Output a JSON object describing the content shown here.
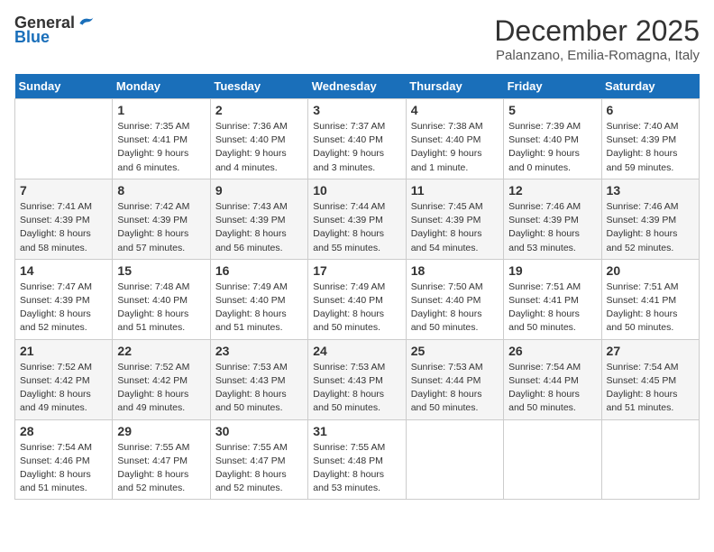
{
  "header": {
    "logo_general": "General",
    "logo_blue": "Blue",
    "month_title": "December 2025",
    "location": "Palanzano, Emilia-Romagna, Italy"
  },
  "days_of_week": [
    "Sunday",
    "Monday",
    "Tuesday",
    "Wednesday",
    "Thursday",
    "Friday",
    "Saturday"
  ],
  "weeks": [
    [
      {
        "day": "",
        "info": ""
      },
      {
        "day": "1",
        "info": "Sunrise: 7:35 AM\nSunset: 4:41 PM\nDaylight: 9 hours\nand 6 minutes."
      },
      {
        "day": "2",
        "info": "Sunrise: 7:36 AM\nSunset: 4:40 PM\nDaylight: 9 hours\nand 4 minutes."
      },
      {
        "day": "3",
        "info": "Sunrise: 7:37 AM\nSunset: 4:40 PM\nDaylight: 9 hours\nand 3 minutes."
      },
      {
        "day": "4",
        "info": "Sunrise: 7:38 AM\nSunset: 4:40 PM\nDaylight: 9 hours\nand 1 minute."
      },
      {
        "day": "5",
        "info": "Sunrise: 7:39 AM\nSunset: 4:40 PM\nDaylight: 9 hours\nand 0 minutes."
      },
      {
        "day": "6",
        "info": "Sunrise: 7:40 AM\nSunset: 4:39 PM\nDaylight: 8 hours\nand 59 minutes."
      }
    ],
    [
      {
        "day": "7",
        "info": "Sunrise: 7:41 AM\nSunset: 4:39 PM\nDaylight: 8 hours\nand 58 minutes."
      },
      {
        "day": "8",
        "info": "Sunrise: 7:42 AM\nSunset: 4:39 PM\nDaylight: 8 hours\nand 57 minutes."
      },
      {
        "day": "9",
        "info": "Sunrise: 7:43 AM\nSunset: 4:39 PM\nDaylight: 8 hours\nand 56 minutes."
      },
      {
        "day": "10",
        "info": "Sunrise: 7:44 AM\nSunset: 4:39 PM\nDaylight: 8 hours\nand 55 minutes."
      },
      {
        "day": "11",
        "info": "Sunrise: 7:45 AM\nSunset: 4:39 PM\nDaylight: 8 hours\nand 54 minutes."
      },
      {
        "day": "12",
        "info": "Sunrise: 7:46 AM\nSunset: 4:39 PM\nDaylight: 8 hours\nand 53 minutes."
      },
      {
        "day": "13",
        "info": "Sunrise: 7:46 AM\nSunset: 4:39 PM\nDaylight: 8 hours\nand 52 minutes."
      }
    ],
    [
      {
        "day": "14",
        "info": "Sunrise: 7:47 AM\nSunset: 4:39 PM\nDaylight: 8 hours\nand 52 minutes."
      },
      {
        "day": "15",
        "info": "Sunrise: 7:48 AM\nSunset: 4:40 PM\nDaylight: 8 hours\nand 51 minutes."
      },
      {
        "day": "16",
        "info": "Sunrise: 7:49 AM\nSunset: 4:40 PM\nDaylight: 8 hours\nand 51 minutes."
      },
      {
        "day": "17",
        "info": "Sunrise: 7:49 AM\nSunset: 4:40 PM\nDaylight: 8 hours\nand 50 minutes."
      },
      {
        "day": "18",
        "info": "Sunrise: 7:50 AM\nSunset: 4:40 PM\nDaylight: 8 hours\nand 50 minutes."
      },
      {
        "day": "19",
        "info": "Sunrise: 7:51 AM\nSunset: 4:41 PM\nDaylight: 8 hours\nand 50 minutes."
      },
      {
        "day": "20",
        "info": "Sunrise: 7:51 AM\nSunset: 4:41 PM\nDaylight: 8 hours\nand 50 minutes."
      }
    ],
    [
      {
        "day": "21",
        "info": "Sunrise: 7:52 AM\nSunset: 4:42 PM\nDaylight: 8 hours\nand 49 minutes."
      },
      {
        "day": "22",
        "info": "Sunrise: 7:52 AM\nSunset: 4:42 PM\nDaylight: 8 hours\nand 49 minutes."
      },
      {
        "day": "23",
        "info": "Sunrise: 7:53 AM\nSunset: 4:43 PM\nDaylight: 8 hours\nand 50 minutes."
      },
      {
        "day": "24",
        "info": "Sunrise: 7:53 AM\nSunset: 4:43 PM\nDaylight: 8 hours\nand 50 minutes."
      },
      {
        "day": "25",
        "info": "Sunrise: 7:53 AM\nSunset: 4:44 PM\nDaylight: 8 hours\nand 50 minutes."
      },
      {
        "day": "26",
        "info": "Sunrise: 7:54 AM\nSunset: 4:44 PM\nDaylight: 8 hours\nand 50 minutes."
      },
      {
        "day": "27",
        "info": "Sunrise: 7:54 AM\nSunset: 4:45 PM\nDaylight: 8 hours\nand 51 minutes."
      }
    ],
    [
      {
        "day": "28",
        "info": "Sunrise: 7:54 AM\nSunset: 4:46 PM\nDaylight: 8 hours\nand 51 minutes."
      },
      {
        "day": "29",
        "info": "Sunrise: 7:55 AM\nSunset: 4:47 PM\nDaylight: 8 hours\nand 52 minutes."
      },
      {
        "day": "30",
        "info": "Sunrise: 7:55 AM\nSunset: 4:47 PM\nDaylight: 8 hours\nand 52 minutes."
      },
      {
        "day": "31",
        "info": "Sunrise: 7:55 AM\nSunset: 4:48 PM\nDaylight: 8 hours\nand 53 minutes."
      },
      {
        "day": "",
        "info": ""
      },
      {
        "day": "",
        "info": ""
      },
      {
        "day": "",
        "info": ""
      }
    ]
  ]
}
